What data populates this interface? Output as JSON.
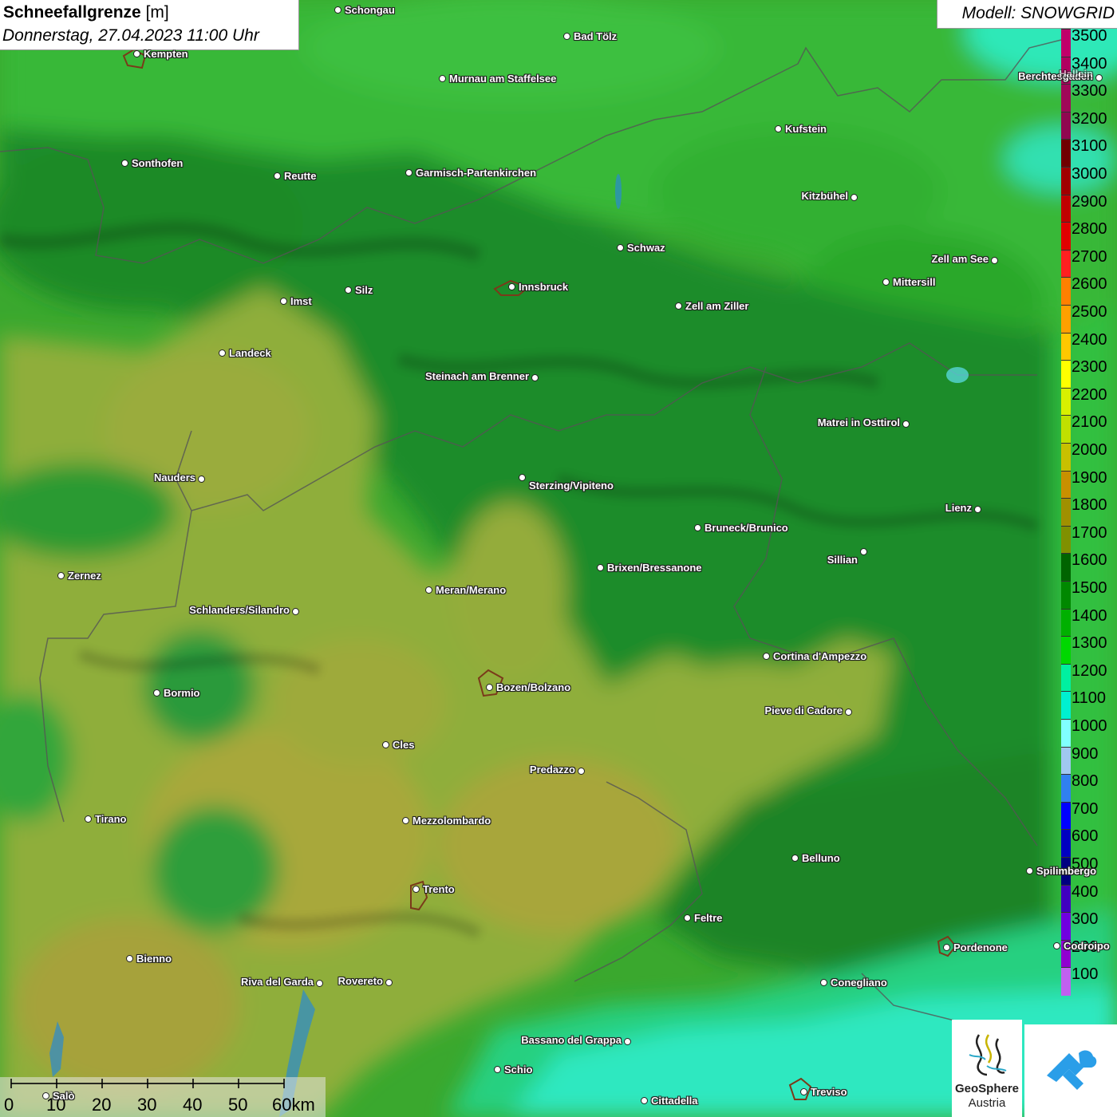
{
  "title": {
    "variable": "Schneefallgrenze",
    "unit": "[m]",
    "datetime": "Donnerstag, 27.04.2023 11:00 Uhr"
  },
  "model_label": "Modell: SNOWGRID",
  "legend": {
    "values": [
      "3500",
      "3400",
      "3300",
      "3200",
      "3100",
      "3000",
      "2900",
      "2800",
      "2700",
      "2600",
      "2500",
      "2400",
      "2300",
      "2200",
      "2100",
      "2000",
      "1900",
      "1800",
      "1700",
      "1600",
      "1500",
      "1400",
      "1300",
      "1200",
      "1100",
      "1000",
      "900",
      "800",
      "700",
      "600",
      "500",
      "400",
      "300",
      "200",
      "100"
    ],
    "colors": [
      "#c0006a",
      "#b00060",
      "#a00858",
      "#900850",
      "#700000",
      "#a00000",
      "#c00000",
      "#e00000",
      "#ff2020",
      "#ff8000",
      "#ffa000",
      "#ffc800",
      "#ffff00",
      "#d8f000",
      "#c0e000",
      "#c8c000",
      "#c89000",
      "#a09000",
      "#809000",
      "#006400",
      "#008800",
      "#00b000",
      "#00d800",
      "#00f0a0",
      "#00f0d0",
      "#80ffff",
      "#a0c8f0",
      "#3080f0",
      "#0000ff",
      "#0000c0",
      "#000080",
      "#4000c0",
      "#7000e0",
      "#9000d0",
      "#c060f0"
    ]
  },
  "cities": [
    {
      "name": "Schongau"
    },
    {
      "name": "Bad Tölz"
    },
    {
      "name": "Kempten"
    },
    {
      "name": "Murnau am Staffelsee"
    },
    {
      "name": "Kufstein"
    },
    {
      "name": "Berchtesgaden"
    },
    {
      "name": "Hallein"
    },
    {
      "name": "Sonthofen"
    },
    {
      "name": "Reutte"
    },
    {
      "name": "Garmisch-Partenkirchen"
    },
    {
      "name": "Kitzbühel"
    },
    {
      "name": "Schwaz"
    },
    {
      "name": "Zell am See"
    },
    {
      "name": "Mittersill"
    },
    {
      "name": "Innsbruck"
    },
    {
      "name": "Silz"
    },
    {
      "name": "Imst"
    },
    {
      "name": "Zell am Ziller"
    },
    {
      "name": "Landeck"
    },
    {
      "name": "Steinach am Brenner"
    },
    {
      "name": "Matrei in Osttirol"
    },
    {
      "name": "Nauders"
    },
    {
      "name": "Sterzing/Vipiteno"
    },
    {
      "name": "Lienz"
    },
    {
      "name": "Bruneck/Brunico"
    },
    {
      "name": "Sillian"
    },
    {
      "name": "Zernez"
    },
    {
      "name": "Brixen/Bressanone"
    },
    {
      "name": "Meran/Merano"
    },
    {
      "name": "Schlanders/Silandro"
    },
    {
      "name": "Cortina d'Ampezzo"
    },
    {
      "name": "Bozen/Bolzano"
    },
    {
      "name": "Bormio"
    },
    {
      "name": "Pieve di Cadore"
    },
    {
      "name": "Cles"
    },
    {
      "name": "Predazzo"
    },
    {
      "name": "Tirano"
    },
    {
      "name": "Mezzolombardo"
    },
    {
      "name": "Belluno"
    },
    {
      "name": "Spilimbergo"
    },
    {
      "name": "Trento"
    },
    {
      "name": "Feltre"
    },
    {
      "name": "Pordenone"
    },
    {
      "name": "Codroipo"
    },
    {
      "name": "Bienno"
    },
    {
      "name": "Riva del Garda"
    },
    {
      "name": "Rovereto"
    },
    {
      "name": "Conegliano"
    },
    {
      "name": "Bassano del Grappa"
    },
    {
      "name": "Schio"
    },
    {
      "name": "Treviso"
    },
    {
      "name": "Cittadella"
    },
    {
      "name": "Salò"
    }
  ],
  "scale_bar": {
    "labels": [
      "0",
      "10",
      "20",
      "30",
      "40",
      "50",
      "60km"
    ]
  },
  "logos": {
    "geosphere_name": "GeoSphere",
    "geosphere_sub": "Austria"
  }
}
